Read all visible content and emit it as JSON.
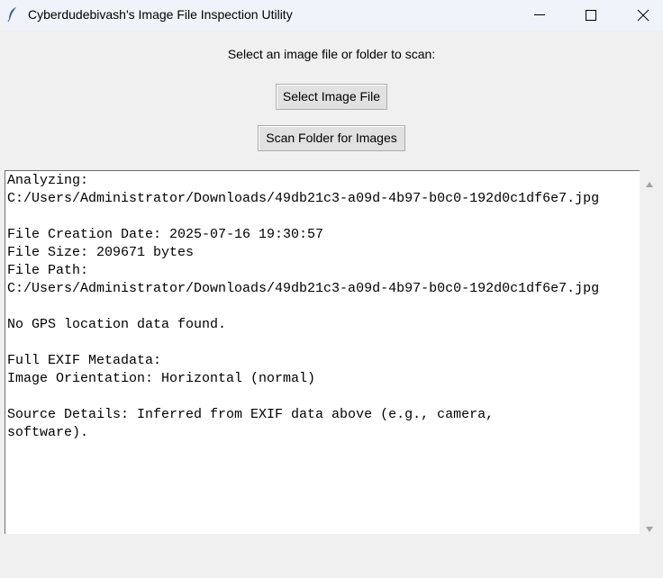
{
  "window": {
    "title": "Cyberdudebivash's Image File Inspection Utility",
    "icons": {
      "app": "feather-icon",
      "minimize": "minimize-icon",
      "maximize": "maximize-icon",
      "close": "close-icon"
    }
  },
  "main": {
    "prompt": "Select an image file or folder to scan:",
    "select_file_button": "Select Image File",
    "scan_folder_button": "Scan Folder for Images"
  },
  "output": {
    "text": "Analyzing:\nC:/Users/Administrator/Downloads/49db21c3-a09d-4b97-b0c0-192d0c1df6e7.jpg\n\nFile Creation Date: 2025-07-16 19:30:57\nFile Size: 209671 bytes\nFile Path:\nC:/Users/Administrator/Downloads/49db21c3-a09d-4b97-b0c0-192d0c1df6e7.jpg\n\nNo GPS location data found.\n\nFull EXIF Metadata:\nImage Orientation: Horizontal (normal)\n\nSource Details: Inferred from EXIF data above (e.g., camera,\nsoftware)."
  },
  "scrollbar": {
    "up_icon": "scroll-up-arrow-icon",
    "down_icon": "scroll-down-arrow-icon"
  }
}
